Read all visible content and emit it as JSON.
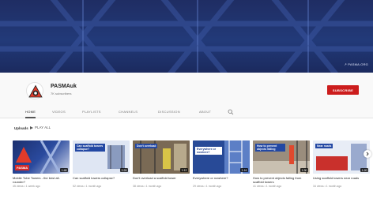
{
  "banner": {
    "link_text": "↗ PASMA.ORG"
  },
  "channel": {
    "name": "PASMAuk",
    "subscribers": "7K subscribers",
    "subscribe_label": "SUBSCRIBE",
    "avatar_icon": "warning-triangle-logo-icon",
    "brand_color": "#cc1d1d"
  },
  "tabs": [
    {
      "label": "HOME",
      "active": true
    },
    {
      "label": "VIDEOS",
      "active": false
    },
    {
      "label": "PLAYLISTS",
      "active": false
    },
    {
      "label": "CHANNELS",
      "active": false
    },
    {
      "label": "DISCUSSION",
      "active": false
    },
    {
      "label": "ABOUT",
      "active": false
    }
  ],
  "tab_search_icon": "search-icon",
  "section": {
    "title": "Uploads",
    "play_all": "PLAY ALL"
  },
  "videos": [
    {
      "title": "Mobile Tube Towers - the best all-rounder?",
      "views": "45 views",
      "age": "1 week ago",
      "duration": "1:48",
      "thumb_text": "PASMA"
    },
    {
      "title": "Can scaffold towers collapse?",
      "views": "52 views",
      "age": "1 month ago",
      "duration": "1:24",
      "thumb_text": "Can scaffold towers collapse?"
    },
    {
      "title": "Don't overload a scaffold tower",
      "views": "38 views",
      "age": "1 month ago",
      "duration": "1:12",
      "thumb_text": "Don't overload"
    },
    {
      "title": "Everywhere or nowhere?",
      "views": "29 views",
      "age": "1 month ago",
      "duration": "1:16",
      "thumb_text": "Everywhere or nowhere?"
    },
    {
      "title": "How to prevent objects falling from scaffold towers",
      "views": "41 views",
      "age": "1 month ago",
      "duration": "1:30",
      "thumb_text": "How to prevent objects falling"
    },
    {
      "title": "Using scaffold towers near roads",
      "views": "34 views",
      "age": "1 month ago",
      "duration": "1:20",
      "thumb_text": "Near roads"
    }
  ],
  "next_icon": "chevron-right-icon"
}
